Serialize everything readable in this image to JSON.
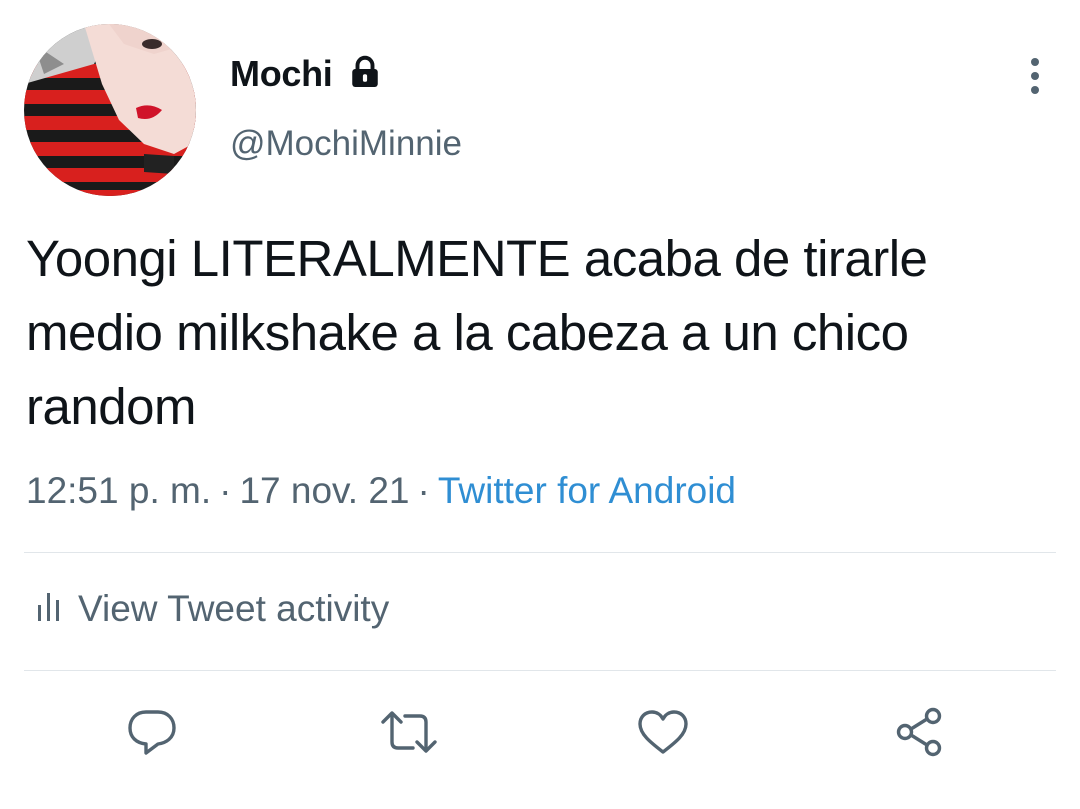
{
  "tweet": {
    "author": {
      "display_name": "Mochi",
      "handle": "@MochiMinnie",
      "protected_icon": "lock-icon",
      "avatar_icon": "profile-photo"
    },
    "text": "Yoongi LITERALMENTE acaba de tirarle medio milkshake a la cabeza a un chico random",
    "time": "12:51 p. m.",
    "separator": "·",
    "date": "17 nov. 21",
    "source": "Twitter for Android",
    "more_icon": "more-vertical-icon"
  },
  "activity": {
    "label": "View Tweet activity",
    "icon": "bar-chart-icon"
  },
  "actions": [
    {
      "name": "reply",
      "icon": "reply-icon"
    },
    {
      "name": "retweet",
      "icon": "retweet-icon"
    },
    {
      "name": "like",
      "icon": "heart-icon"
    },
    {
      "name": "share",
      "icon": "share-icon"
    }
  ],
  "colors": {
    "text": "#0f1419",
    "secondary": "#536471",
    "link": "#2f8ed3",
    "divider": "#e1e6ea",
    "icon": "#536471"
  }
}
